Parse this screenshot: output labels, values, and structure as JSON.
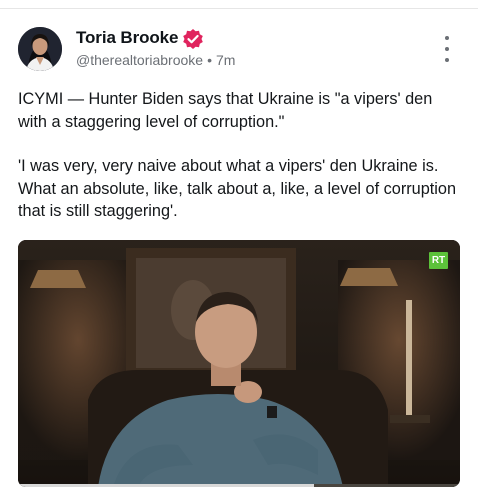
{
  "author": {
    "name": "Toria Brooke",
    "handle": "@therealtoriabrooke",
    "separator": "•",
    "time": "7m",
    "verified_color": "#e0245e"
  },
  "tweet": {
    "paragraph_1": "ICYMI — Hunter Biden says that Ukraine is \"a vipers' den with a staggering level of corruption.\"",
    "paragraph_2": "'I was very, very naive about what a vipers' den Ukraine is. What an absolute, like, talk about a, like, a level of corruption that is still staggering'."
  },
  "media": {
    "channel_logo": "RT",
    "progress_fraction": 0.67
  },
  "icons": [
    "avatar",
    "verified-badge-icon",
    "more-options-icon"
  ]
}
